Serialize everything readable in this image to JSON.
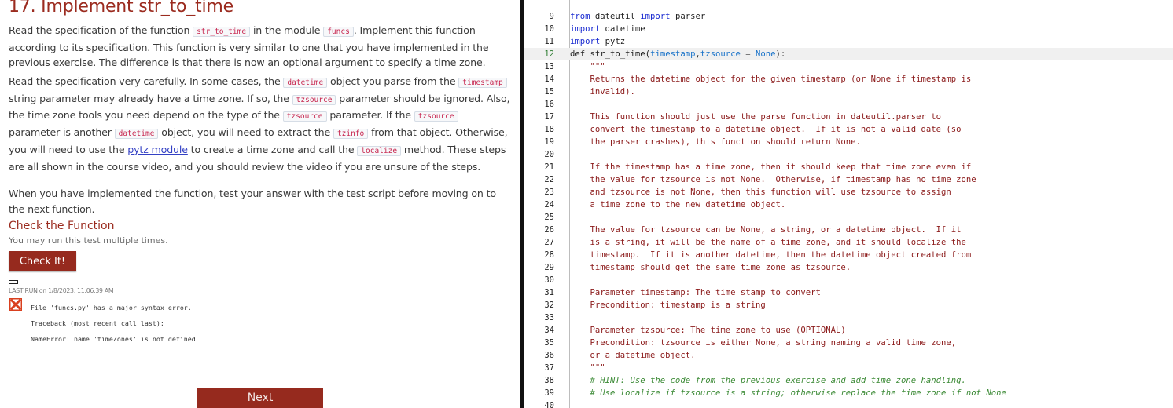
{
  "exercise": {
    "title": "17. Implement str_to_time",
    "para1": {
      "t1": "Read the specification of the function ",
      "c1": "str_to_time",
      "t2": " in the module ",
      "c2": "funcs",
      "t3": ". Implement this function according to its specification. This function is very similar to one that you have implemented in the previous exercise. The difference is that there is now an optional argument to specify a time zone."
    },
    "para2": {
      "t1": "Read the specification very carefully. In some cases, the ",
      "c1": "datetime",
      "t2": " object you parse from the ",
      "c2": "timestamp",
      "t3": " string parameter may already have a time zone. If so, the ",
      "c3": "tzsource",
      "t4": " parameter should be ignored. Also, the time zone tools you need depend on the type of the ",
      "c4": "tzsource",
      "t5": " parameter. If the ",
      "c5": "tzsource",
      "t6": " parameter is another ",
      "c6": "datetime",
      "t7": " object, you will need to extract the ",
      "c7": "tzinfo",
      "t8": " from that object. Otherwise, you will need to use the ",
      "link": "pytz module",
      "t9": " to create a time zone and call the ",
      "c8": "localize",
      "t10": " method. These steps are all shown in the course video, and you should review the video if you are unsure of the steps."
    },
    "para3": "When you have implemented the function, test your answer with the test script before moving on to the next function."
  },
  "check": {
    "heading": "Check the Function",
    "subtitle": "You may run this test multiple times.",
    "button_label": "Check It!",
    "last_run": "LAST RUN on 1/8/2023, 11:06:39 AM",
    "status_icon": "fail-x-icon",
    "status_color": "#d9401f",
    "results": [
      "File 'funcs.py' has a major syntax error.",
      "Traceback (most recent call last):",
      "NameError: name 'timeZones' is not defined"
    ]
  },
  "nav": {
    "next_label": "Next"
  },
  "colors": {
    "accent": "#962a1e",
    "title": "#9b2b1f",
    "link": "#3340c4",
    "keyword": "#1a2bd1",
    "docstring": "#8b1a1a",
    "comment": "#3d8b37"
  },
  "editor": {
    "active_line": 12,
    "lines": [
      {
        "n": "9",
        "tokens": [
          [
            "kw",
            "from"
          ],
          [
            "def",
            " dateutil "
          ],
          [
            "kw",
            "import"
          ],
          [
            "def",
            " parser"
          ]
        ]
      },
      {
        "n": "10",
        "tokens": [
          [
            "kw",
            "import"
          ],
          [
            "def",
            " datetime"
          ]
        ]
      },
      {
        "n": "11",
        "tokens": [
          [
            "kw",
            "import"
          ],
          [
            "def",
            " pytz"
          ]
        ]
      },
      {
        "n": "12",
        "tokens": [
          [
            "def",
            "def str_to_time("
          ],
          [
            "param",
            "timestamp"
          ],
          [
            "def",
            ","
          ],
          [
            "param",
            "tzsource"
          ],
          [
            "op",
            " = "
          ],
          [
            "cst",
            "None"
          ],
          [
            "def",
            "):"
          ]
        ]
      },
      {
        "n": "13",
        "tokens": [
          [
            "str",
            "    \"\"\""
          ]
        ]
      },
      {
        "n": "14",
        "tokens": [
          [
            "str",
            "    Returns the datetime object for the given timestamp (or None if timestamp is"
          ]
        ]
      },
      {
        "n": "15",
        "tokens": [
          [
            "str",
            "    invalid)."
          ]
        ]
      },
      {
        "n": "16",
        "tokens": []
      },
      {
        "n": "17",
        "tokens": [
          [
            "str",
            "    This function should just use the parse function in dateutil.parser to"
          ]
        ]
      },
      {
        "n": "18",
        "tokens": [
          [
            "str",
            "    convert the timestamp to a datetime object.  If it is not a valid date (so"
          ]
        ]
      },
      {
        "n": "19",
        "tokens": [
          [
            "str",
            "    the parser crashes), this function should return None."
          ]
        ]
      },
      {
        "n": "20",
        "tokens": []
      },
      {
        "n": "21",
        "tokens": [
          [
            "str",
            "    If the timestamp has a time zone, then it should keep that time zone even if"
          ]
        ]
      },
      {
        "n": "22",
        "tokens": [
          [
            "str",
            "    the value for tzsource is not None.  Otherwise, if timestamp has no time zone"
          ]
        ]
      },
      {
        "n": "23",
        "tokens": [
          [
            "str",
            "    and tzsource is not None, then this function will use tzsource to assign"
          ]
        ]
      },
      {
        "n": "24",
        "tokens": [
          [
            "str",
            "    a time zone to the new datetime object."
          ]
        ]
      },
      {
        "n": "25",
        "tokens": []
      },
      {
        "n": "26",
        "tokens": [
          [
            "str",
            "    The value for tzsource can be None, a string, or a datetime object.  If it"
          ]
        ]
      },
      {
        "n": "27",
        "tokens": [
          [
            "str",
            "    is a string, it will be the name of a time zone, and it should localize the"
          ]
        ]
      },
      {
        "n": "28",
        "tokens": [
          [
            "str",
            "    timestamp.  If it is another datetime, then the datetime object created from"
          ]
        ]
      },
      {
        "n": "29",
        "tokens": [
          [
            "str",
            "    timestamp should get the same time zone as tzsource."
          ]
        ]
      },
      {
        "n": "30",
        "tokens": []
      },
      {
        "n": "31",
        "tokens": [
          [
            "str",
            "    Parameter timestamp: The time stamp to convert"
          ]
        ]
      },
      {
        "n": "32",
        "tokens": [
          [
            "str",
            "    Precondition: timestamp is a string"
          ]
        ]
      },
      {
        "n": "33",
        "tokens": []
      },
      {
        "n": "34",
        "tokens": [
          [
            "str",
            "    Parameter tzsource: The time zone to use (OPTIONAL)"
          ]
        ]
      },
      {
        "n": "35",
        "tokens": [
          [
            "str",
            "    Precondition: tzsource is either None, a string naming a valid time zone,"
          ]
        ]
      },
      {
        "n": "36",
        "tokens": [
          [
            "str",
            "    or a datetime object."
          ]
        ]
      },
      {
        "n": "37",
        "tokens": [
          [
            "str",
            "    \"\"\""
          ]
        ]
      },
      {
        "n": "38",
        "tokens": [
          [
            "com",
            "    # HINT: Use the code from the previous exercise and add time zone handling."
          ]
        ]
      },
      {
        "n": "39",
        "tokens": [
          [
            "com",
            "    # Use localize if tzsource is a string; otherwise replace the time zone if not None"
          ]
        ]
      },
      {
        "n": "40",
        "tokens": []
      }
    ]
  }
}
